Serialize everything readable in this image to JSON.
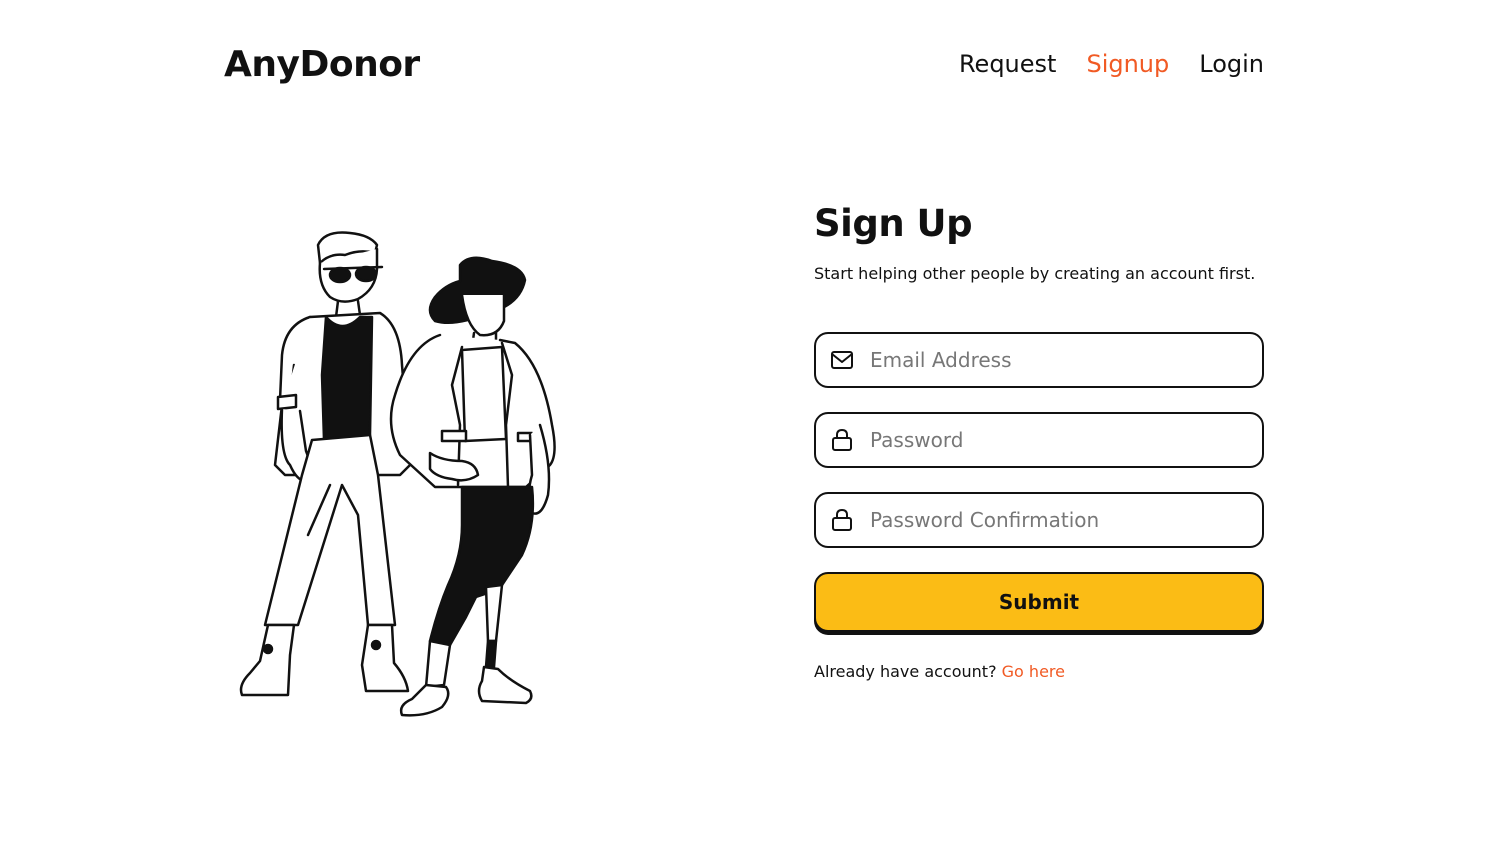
{
  "header": {
    "logo": "AnyDonor",
    "nav": [
      {
        "label": "Request",
        "active": false
      },
      {
        "label": "Signup",
        "active": true
      },
      {
        "label": "Login",
        "active": false
      }
    ]
  },
  "form": {
    "title": "Sign Up",
    "subtitle": "Start helping other people by creating an account first.",
    "email_placeholder": "Email Address",
    "password_placeholder": "Password",
    "password_confirm_placeholder": "Password Confirmation",
    "submit_label": "Submit",
    "already_text": "Already have account?",
    "login_link": "Go here"
  },
  "icons": {
    "email": "mail-icon",
    "password": "lock-icon",
    "password_confirm": "lock-icon"
  },
  "colors": {
    "accent": "#f15a24",
    "button": "#fbbc15",
    "text": "#111111"
  }
}
